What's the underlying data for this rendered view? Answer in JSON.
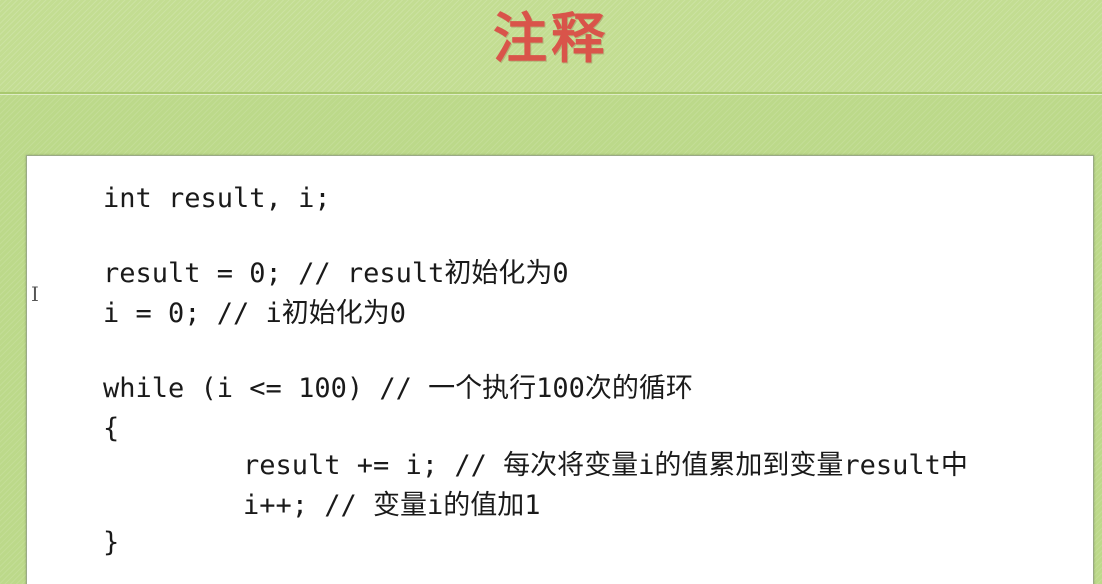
{
  "slide": {
    "title": "注释"
  },
  "code": {
    "lines": [
      "int result, i;",
      "result = 0; // result初始化为0",
      "i = 0; // i初始化为0",
      "while (i <= 100) // 一个执行100次的循环",
      "{",
      "result += i; // 每次将变量i的值累加到变量result中",
      "i++; // 变量i的值加1",
      "}"
    ]
  },
  "cursor": {
    "glyph": "I"
  },
  "colors": {
    "background": "#bcd98a",
    "title": "#d9544a",
    "panel": "#ffffff",
    "code_text": "#1a1a1a"
  }
}
